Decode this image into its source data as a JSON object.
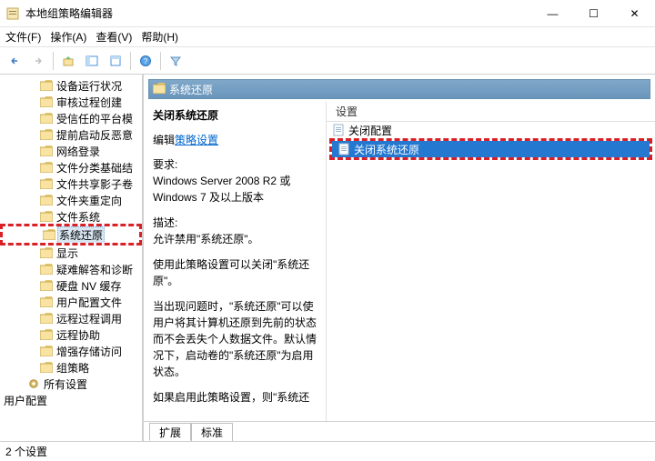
{
  "title": "本地组策略编辑器",
  "window_controls": {
    "min": "—",
    "max": "☐",
    "close": "✕"
  },
  "menu": {
    "file": "文件(F)",
    "action": "操作(A)",
    "view": "查看(V)",
    "help": "帮助(H)"
  },
  "tree": {
    "items": [
      "设备运行状况",
      "审核过程创建",
      "受信任的平台模",
      "提前启动反恶意",
      "网络登录",
      "文件分类基础结",
      "文件共享影子卷",
      "文件夹重定向",
      "文件系统",
      "系统还原",
      "显示",
      "疑难解答和诊断",
      "硬盘 NV 缓存",
      "用户配置文件",
      "远程过程调用",
      "远程协助",
      "增强存储访问",
      "组策略"
    ],
    "all_settings": "所有设置",
    "user_config": "用户配置"
  },
  "header": {
    "title": "系统还原"
  },
  "desc": {
    "policy_title": "关闭系统还原",
    "edit_link_prefix": "编辑",
    "edit_link": "策略设置",
    "req_label": "要求:",
    "requirement": "Windows Server 2008 R2 或 Windows 7 及以上版本",
    "desc_label": "描述:",
    "desc1": "允许禁用\"系统还原\"。",
    "desc2": "使用此策略设置可以关闭\"系统还原\"。",
    "desc3": "当出现问题时，\"系统还原\"可以使用户将其计算机还原到先前的状态而不会丢失个人数据文件。默认情况下，启动卷的\"系统还原\"为启用状态。",
    "desc4": "如果启用此策略设置，则\"系统还"
  },
  "list": {
    "header": "设置",
    "items": [
      "关闭配置",
      "关闭系统还原"
    ]
  },
  "tabs": {
    "extended": "扩展",
    "standard": "标准"
  },
  "status": "2 个设置"
}
